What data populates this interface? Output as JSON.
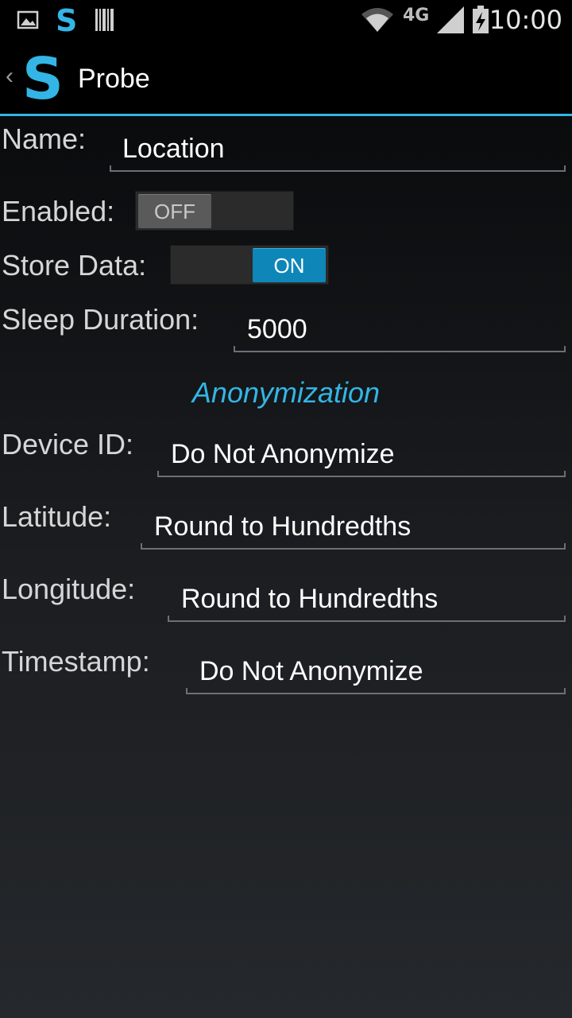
{
  "status_bar": {
    "time": "10:00",
    "network_label": "4G",
    "icons": [
      "image-notification-icon",
      "app-s-notification-icon",
      "barcode-notification-icon",
      "wifi-icon",
      "signal-icon",
      "battery-charging-icon"
    ]
  },
  "action_bar": {
    "up_glyph": "‹",
    "logo_letter": "S",
    "title": "Probe"
  },
  "form": {
    "name": {
      "label": "Name:",
      "value": "Location"
    },
    "enabled": {
      "label": "Enabled:",
      "state_text": "OFF",
      "on": false
    },
    "store_data": {
      "label": "Store Data:",
      "state_text": "ON",
      "on": true
    },
    "sleep_duration": {
      "label": "Sleep Duration:",
      "value": "5000"
    }
  },
  "anonymization": {
    "header": "Anonymization",
    "device_id": {
      "label": "Device ID:",
      "value": "Do Not Anonymize"
    },
    "latitude": {
      "label": "Latitude:",
      "value": "Round to Hundredths"
    },
    "longitude": {
      "label": "Longitude:",
      "value": "Round to Hundredths"
    },
    "timestamp": {
      "label": "Timestamp:",
      "value": "Do Not Anonymize"
    }
  },
  "colors": {
    "accent": "#33b5e5",
    "switch_on": "#0e86b8",
    "switch_off": "#5a5a5a"
  }
}
